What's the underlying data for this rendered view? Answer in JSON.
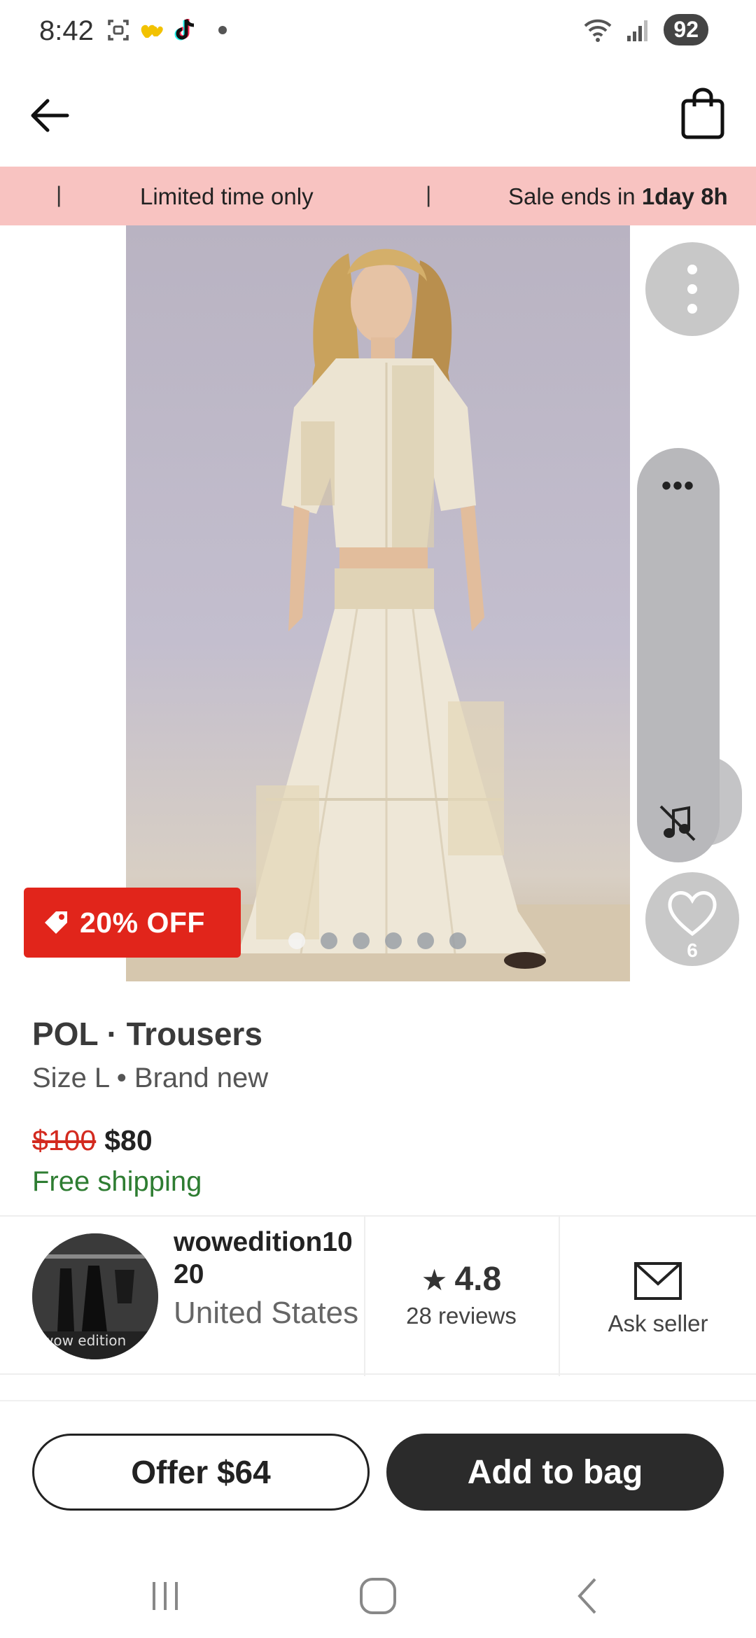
{
  "status_bar": {
    "time": "8:42",
    "battery": "92",
    "icons": [
      "screenshot-icon",
      "hearts-icon",
      "tiktok-icon",
      "wifi-icon",
      "signal-icon"
    ]
  },
  "header": {
    "back_icon": "arrow-left-icon",
    "bag_icon": "shopping-bag-icon"
  },
  "promo": {
    "separator": "|",
    "limited": "Limited time only",
    "sale_prefix": "Sale ends in",
    "sale_time": "1day 8h"
  },
  "product": {
    "discount_badge": "20% OFF",
    "title": "POL · Trousers",
    "meta": "Size L • Brand new",
    "price_old": "$100",
    "price_new": "$80",
    "shipping": "Free shipping",
    "image_count": 6,
    "active_image": 1,
    "likes": "6"
  },
  "side_actions": {
    "more_dots": "•••"
  },
  "seller": {
    "name": "wowedition1020",
    "location": "United States",
    "rating": "4.8",
    "reviews": "28 reviews",
    "ask_label": "Ask seller",
    "avatar_text": "wow edition"
  },
  "actions": {
    "offer_label": "Offer $64",
    "add_label": "Add to bag"
  },
  "colors": {
    "promo_bg": "#f8c3c1",
    "discount_bg": "#e1251b",
    "price_old": "#d32a1f",
    "shipping": "#2e7d32",
    "primary_btn": "#2b2b2b"
  }
}
